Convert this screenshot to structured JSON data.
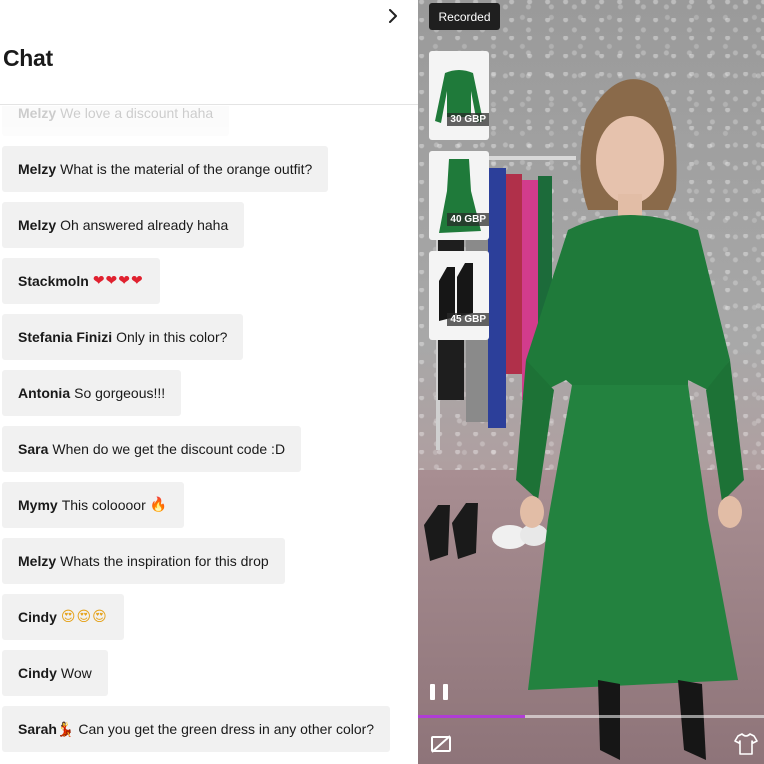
{
  "chat": {
    "title": "Chat",
    "messages": [
      {
        "author": "Melzy",
        "text": "We love a discount haha",
        "faded": true
      },
      {
        "author": "Melzy",
        "text": "What is the material of the orange outfit?"
      },
      {
        "author": "Melzy",
        "text": "Oh answered already haha"
      },
      {
        "author": "Stackmoln",
        "text": "",
        "emoji": "❤❤❤❤",
        "emoji_class": "heart"
      },
      {
        "author": "Stefania Finizi",
        "text": "Only in this color?"
      },
      {
        "author": "Antonia",
        "text": "So gorgeous!!!"
      },
      {
        "author": "Sara",
        "text": "When do we get the discount code :D"
      },
      {
        "author": "Mymy",
        "text": "This coloooor",
        "emoji": "🔥",
        "emoji_class": "fire"
      },
      {
        "author": "Melzy",
        "text": "Whats the inspiration for this drop"
      },
      {
        "author": "Cindy",
        "text": "",
        "emoji": "😍😍😍",
        "emoji_class": "face"
      },
      {
        "author": "Cindy",
        "text": "Wow"
      },
      {
        "author": "Sarah💃",
        "text": "Can you get the green dress in any other color?"
      }
    ]
  },
  "video": {
    "badge": "Recorded",
    "progress": 0.31,
    "products": [
      {
        "price": "30 GBP",
        "item": "green-top"
      },
      {
        "price": "40 GBP",
        "item": "green-skirt"
      },
      {
        "price": "45 GBP",
        "item": "black-boots"
      }
    ],
    "icons": [
      "chevron-right-icon",
      "pause-icon",
      "hide-products-icon",
      "shirt-icon"
    ]
  },
  "colors": {
    "accent": "#b03dd6",
    "bubble": "#f1f1f1",
    "outfit_green": "#1f7a3a"
  }
}
